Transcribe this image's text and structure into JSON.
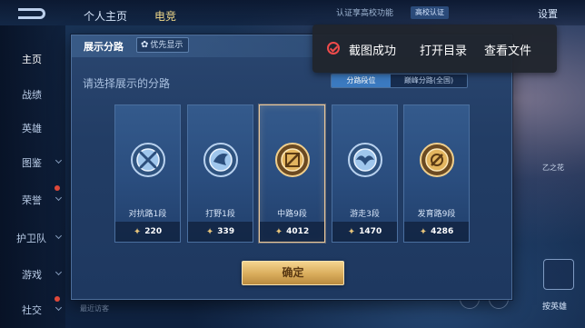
{
  "background": {
    "topbar": {
      "tab_home": "个人主页",
      "tab_second": "电竞",
      "auth_text": "认证享高校功能",
      "auth_badge": "高校认证",
      "settings": "设置"
    },
    "sidebar": {
      "items": [
        {
          "label": "主页",
          "active": true
        },
        {
          "label": "战绩"
        },
        {
          "label": "英雄"
        },
        {
          "label": "图鉴"
        },
        {
          "label": "荣誉"
        },
        {
          "label": "护卫队"
        },
        {
          "label": "游戏"
        },
        {
          "label": "社交"
        }
      ]
    },
    "right_text": "乙之花",
    "bottom_left": "最近访客",
    "rank_label": "按英雄"
  },
  "modal": {
    "title": "展示分路",
    "priority_label": "优先显示",
    "subtitle": "请选择展示的分路",
    "tabs": [
      {
        "label": "分路段位",
        "active": true
      },
      {
        "label": "巅峰分路(全国)",
        "active": false
      }
    ],
    "cards": [
      {
        "name": "对抗路1段",
        "score": "220",
        "emblem": "sword-emblem-icon",
        "selected": false
      },
      {
        "name": "打野1段",
        "score": "339",
        "emblem": "wolf-emblem-icon",
        "selected": false
      },
      {
        "name": "中路9段",
        "score": "4012",
        "emblem": "staff-emblem-icon",
        "selected": true
      },
      {
        "name": "游走3段",
        "score": "1470",
        "emblem": "wing-emblem-icon",
        "selected": false
      },
      {
        "name": "发育路9段",
        "score": "4286",
        "emblem": "bow-emblem-icon",
        "selected": false
      }
    ],
    "confirm_label": "确定"
  },
  "toast": {
    "message": "截图成功",
    "open_dir": "打开目录",
    "view_file": "查看文件",
    "icon": "check-circle-icon"
  },
  "colors": {
    "accent_gold": "#e5c37a",
    "selected_border": "#e9c79a",
    "tab_active": "#3b7ac0",
    "toast_icon": "#ef4b4b"
  }
}
